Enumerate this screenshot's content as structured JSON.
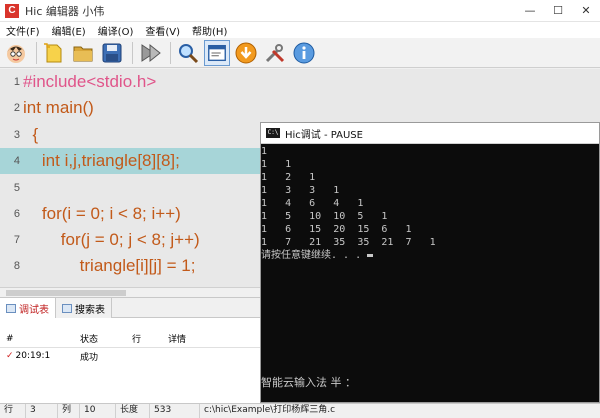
{
  "window": {
    "title": "Hic 编辑器 小伟",
    "app_icon_letter": "C"
  },
  "menu": [
    "文件(F)",
    "编辑(E)",
    "编译(O)",
    "查看(V)",
    "帮助(H)"
  ],
  "toolbar": {
    "icons": [
      "avatar-icon",
      "new-file-icon",
      "open-folder-icon",
      "save-icon",
      "run-icon",
      "search-icon",
      "window-icon",
      "download-icon",
      "tools-icon",
      "info-icon"
    ]
  },
  "editor": {
    "lines": [
      {
        "num": "1",
        "tokens": [
          {
            "t": "#include<stdio.h>",
            "c": "kw-pre"
          }
        ]
      },
      {
        "num": "2",
        "tokens": [
          {
            "t": "int main()",
            "c": "kw"
          }
        ]
      },
      {
        "num": "3",
        "tokens": [
          {
            "t": "  {",
            "c": "kw"
          }
        ]
      },
      {
        "num": "4",
        "tokens": [
          {
            "t": "    int i,j,triangle[8][8];",
            "c": "kw"
          }
        ]
      },
      {
        "num": "5",
        "tokens": [
          {
            "t": "",
            "c": "kw"
          }
        ]
      },
      {
        "num": "6",
        "tokens": [
          {
            "t": "    for(i = 0; i < 8; i++)",
            "c": "kw"
          }
        ]
      },
      {
        "num": "7",
        "tokens": [
          {
            "t": "        for(j = 0; j < 8; j++)",
            "c": "kw"
          }
        ]
      },
      {
        "num": "8",
        "tokens": [
          {
            "t": "            triangle[i][j] = 1;",
            "c": "kw"
          }
        ]
      }
    ]
  },
  "panel": {
    "tabs": [
      "调试表",
      "搜索表"
    ],
    "columns": [
      "#",
      "状态",
      "行",
      "详情"
    ],
    "rows": [
      {
        "time": "20:19:1",
        "status": "成功",
        "line": "",
        "detail": ""
      }
    ]
  },
  "status": {
    "row_label": "行",
    "row_value": "3",
    "col_label": "列",
    "col_value": "10",
    "len_label": "长度",
    "len_value": "533",
    "path": "c:\\hic\\Example\\打印杨辉三角.c"
  },
  "console": {
    "title": "Hic调试 - PAUSE",
    "output": "1\n1   1\n1   2   1\n1   3   3   1\n1   4   6   4   1\n1   5   10  10  5   1\n1   6   15  20  15  6   1\n1   7   21  35  35  21  7   1",
    "prompt": "请按任意键继续. . . ",
    "ime": "智能云输入法 半 ："
  }
}
